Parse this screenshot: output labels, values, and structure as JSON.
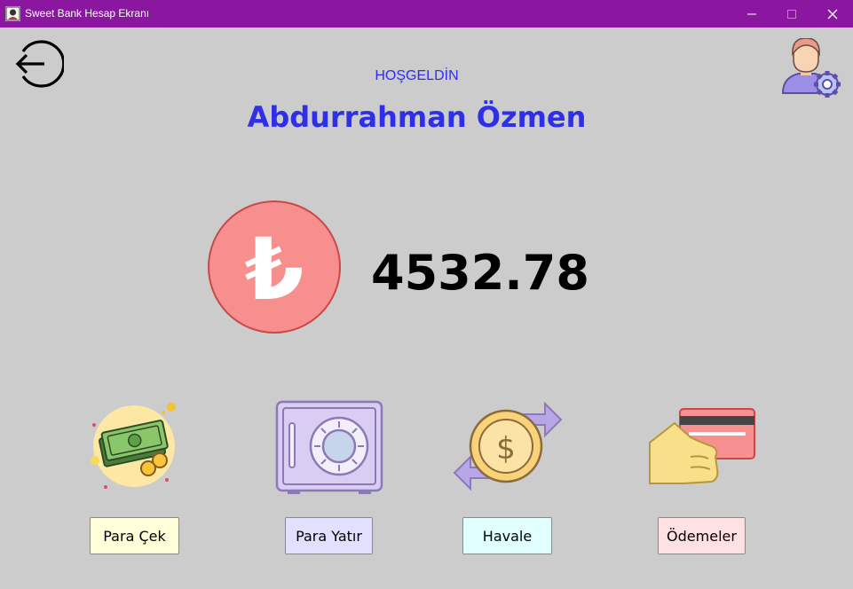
{
  "window": {
    "title": "Sweet Bank Hesap Ekranı"
  },
  "header": {
    "welcome": "HOŞGELDİN",
    "user_name": "Abdurrahman Özmen"
  },
  "account": {
    "currency_symbol": "₺",
    "balance": "4532.78"
  },
  "actions": [
    {
      "label": "Para Çek",
      "icon": "cash-money-icon",
      "color": "#ffffd9"
    },
    {
      "label": "Para Yatır",
      "icon": "safe-vault-icon",
      "color": "#e1e1ff"
    },
    {
      "label": "Havale",
      "icon": "money-transfer-icon",
      "color": "#e1ffff"
    },
    {
      "label": "Ödemeler",
      "icon": "card-payment-icon",
      "color": "#ffe1e1"
    }
  ],
  "colors": {
    "titlebar": "#8b17a0",
    "background": "#cccccc",
    "accent_text": "#2f2fe8",
    "currency_circle": "#f78f8f"
  }
}
